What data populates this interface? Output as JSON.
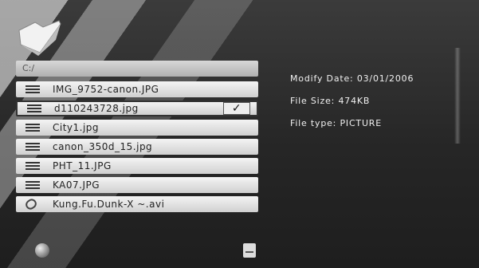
{
  "path": "C:/",
  "files": [
    {
      "name": "IMG_9752-canon.JPG",
      "type": "image",
      "selected": false
    },
    {
      "name": "d110243728.jpg",
      "type": "image",
      "selected": true
    },
    {
      "name": "City1.jpg",
      "type": "image",
      "selected": false
    },
    {
      "name": "canon_350d_15.jpg",
      "type": "image",
      "selected": false
    },
    {
      "name": "PHT_11.JPG",
      "type": "image",
      "selected": false
    },
    {
      "name": "KA07.JPG",
      "type": "image",
      "selected": false
    },
    {
      "name": "Kung.Fu.Dunk-X ~.avi",
      "type": "video",
      "selected": false
    }
  ],
  "checkmark": "✓",
  "info": {
    "modify_date": "Modify Date: 03/01/2006",
    "file_size": "File Size: 474KB",
    "file_type": "File type: PICTURE"
  },
  "icons": [
    "folder-icon",
    "file-icon",
    "video-file-icon",
    "globe-icon",
    "download-icon"
  ]
}
